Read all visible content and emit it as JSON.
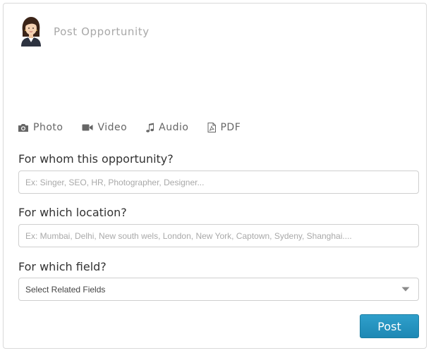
{
  "composer": {
    "placeholder": "Post Opportunity"
  },
  "media": {
    "photo": {
      "label": "Photo",
      "icon": "camera-icon"
    },
    "video": {
      "label": "Video",
      "icon": "video-camera-icon"
    },
    "audio": {
      "label": "Audio",
      "icon": "music-note-icon"
    },
    "pdf": {
      "label": "PDF",
      "icon": "pdf-file-icon"
    }
  },
  "form": {
    "whom": {
      "label": "For whom this opportunity?",
      "placeholder": "Ex: Singer, SEO, HR, Photographer, Designer..."
    },
    "location": {
      "label": "For which location?",
      "placeholder": "Ex: Mumbai, Delhi, New south wels, London, New York, Captown, Sydeny, Shanghai...."
    },
    "field": {
      "label": "For which field?",
      "selected": "Select Related Fields"
    }
  },
  "actions": {
    "post_label": "Post"
  },
  "colors": {
    "accent": "#2391bd",
    "border": "#cfcfcf"
  }
}
